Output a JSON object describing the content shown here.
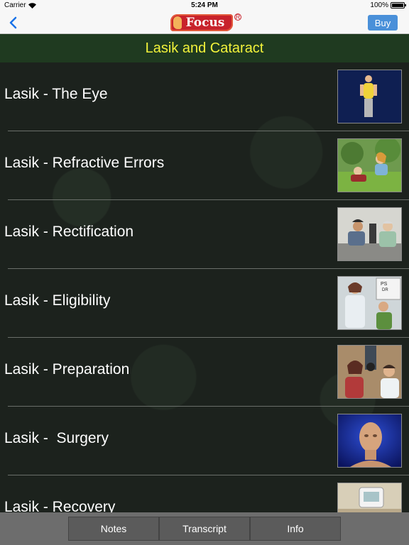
{
  "status_bar": {
    "carrier": "Carrier",
    "time": "5:24 PM",
    "battery": "100%"
  },
  "nav": {
    "logo_text": "Focus",
    "logo_registered": "R",
    "buy_label": "Buy"
  },
  "header": {
    "title": "Lasik and Cataract"
  },
  "lessons": [
    {
      "label": "Lasik - The Eye",
      "thumbnail": "woman-standing-thumbnail"
    },
    {
      "label": "Lasik - Refractive Errors",
      "thumbnail": "couple-on-grass-thumbnail"
    },
    {
      "label": "Lasik - Rectification",
      "thumbnail": "eye-exam-machine-thumbnail"
    },
    {
      "label": "Lasik - Eligibility",
      "thumbnail": "doctor-patient-chart-thumbnail"
    },
    {
      "label": "Lasik - Preparation",
      "thumbnail": "eye-test-preparation-thumbnail"
    },
    {
      "label": "Lasik -  Surgery",
      "thumbnail": "head-3d-model-thumbnail"
    },
    {
      "label": "Lasik - Recovery",
      "thumbnail": "clock-device-thumbnail"
    }
  ],
  "tabs": {
    "notes": "Notes",
    "transcript": "Transcript",
    "info": "Info"
  },
  "colors": {
    "accent": "#4a90d9",
    "header_bg": "#1f3a20",
    "header_text": "#f2f23a",
    "logo_red": "#c8222b"
  }
}
